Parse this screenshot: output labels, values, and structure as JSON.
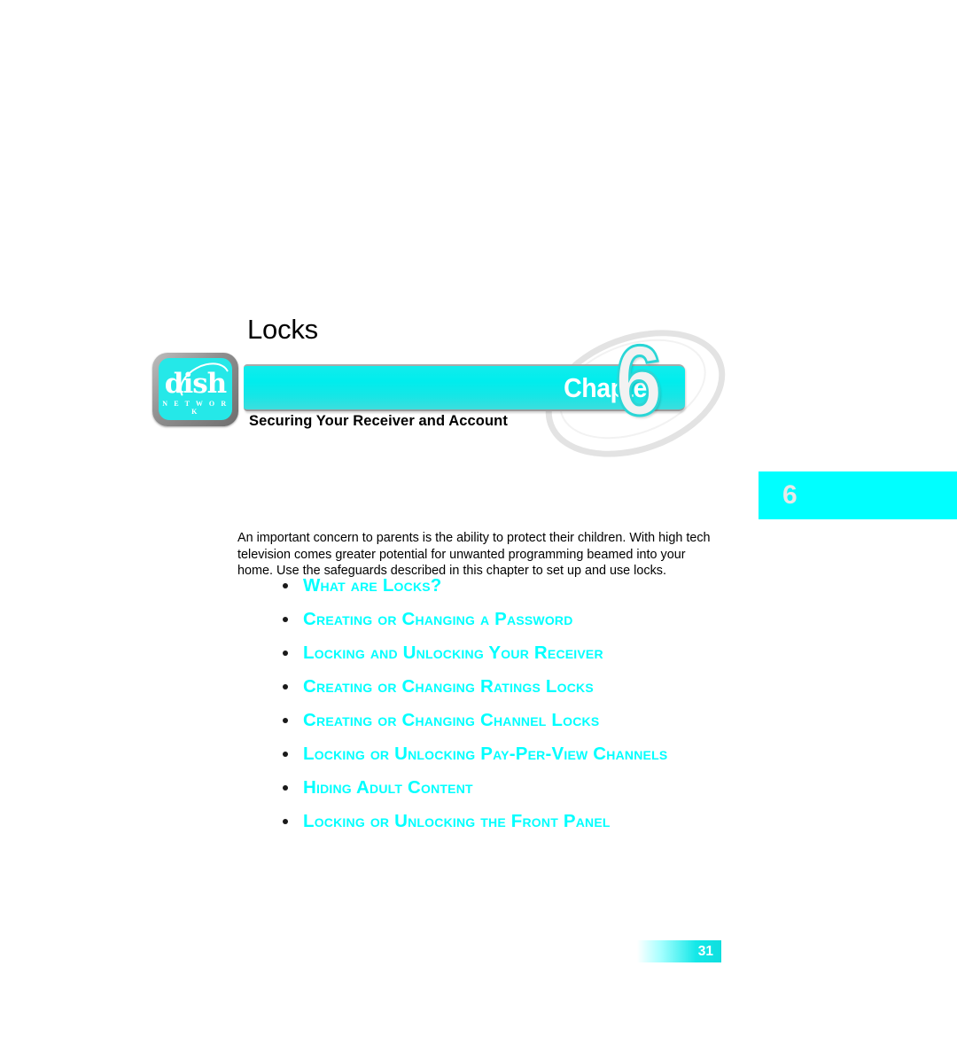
{
  "page": {
    "title": "Locks",
    "chapter_label": "Chapter",
    "chapter_number": "6",
    "chapter_tab_number": "6",
    "subtitle": "Securing Your Receiver and Account",
    "page_number": "31",
    "accent_color": "#00ffff",
    "logo": {
      "wordmark": "dish",
      "network_word": "N E T W O R K"
    },
    "intro_paragraph": "An important concern to parents is the ability to protect their children. With high tech television comes greater potential for unwanted programming beamed into your home. Use the safeguards described in this chapter to set up and use locks.",
    "topics": [
      {
        "label": "What are Locks?"
      },
      {
        "label": "Creating or Changing a Password"
      },
      {
        "label": "Locking and Unlocking Your Receiver"
      },
      {
        "label": "Creating or Changing Ratings Locks"
      },
      {
        "label": "Creating or Changing Channel Locks"
      },
      {
        "label": "Locking or Unlocking Pay-Per-View Channels"
      },
      {
        "label": "Hiding Adult Content"
      },
      {
        "label": "Locking or Unlocking the Front Panel"
      }
    ]
  }
}
